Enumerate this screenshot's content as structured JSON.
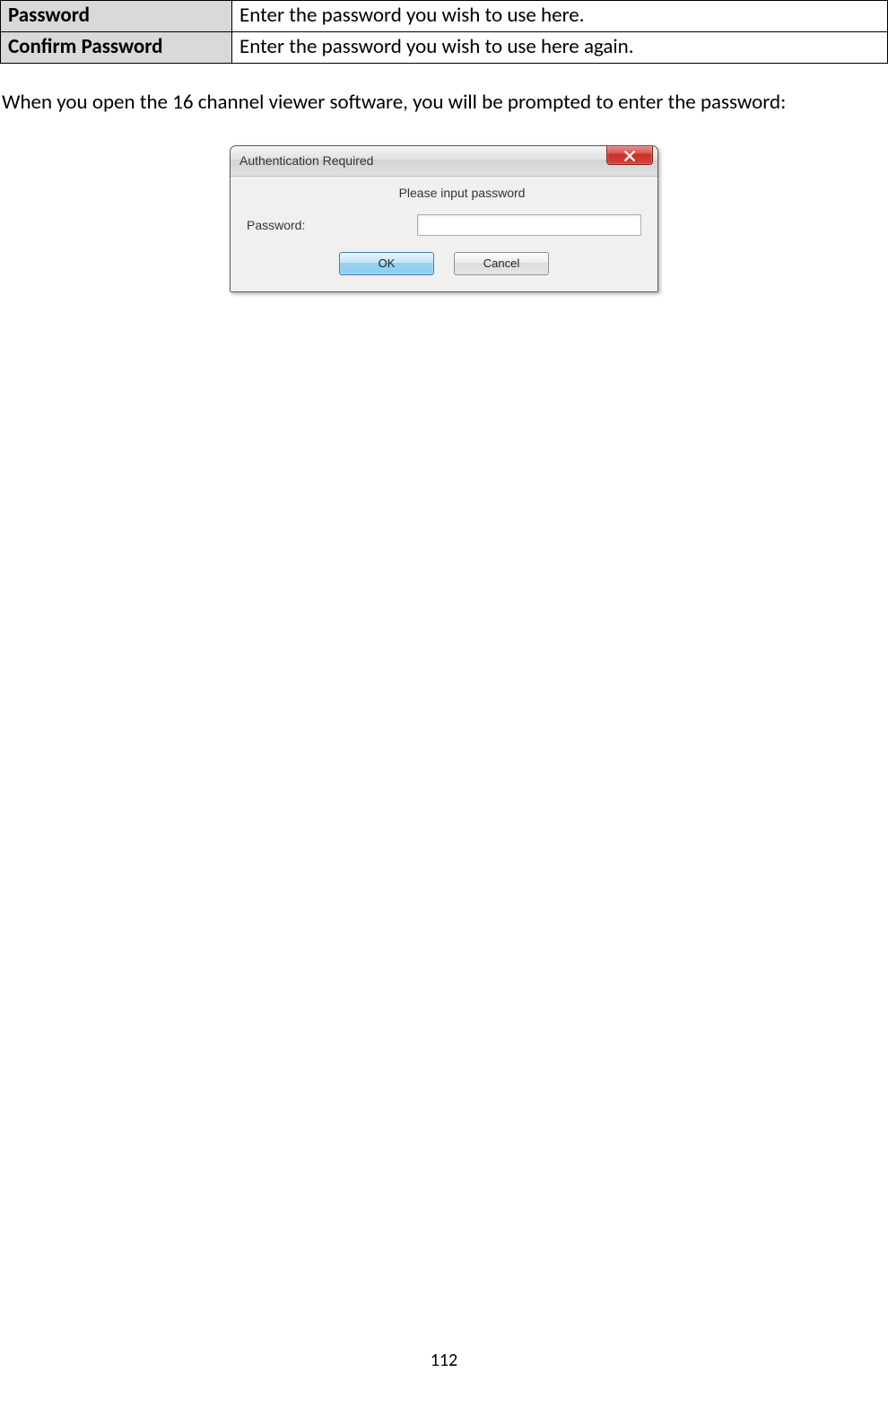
{
  "table": {
    "rows": [
      {
        "label": "Password",
        "desc": "Enter the password you wish to use here."
      },
      {
        "label": "Confirm Password",
        "desc": "Enter the password you wish to use here again."
      }
    ]
  },
  "paragraph": "When you open the 16 channel viewer software, you will be prompted to enter the password:",
  "dialog": {
    "title": "Authentication Required",
    "instruction": "Please input password",
    "field_label": "Password:",
    "ok_label": "OK",
    "cancel_label": "Cancel"
  },
  "page_number": "112"
}
